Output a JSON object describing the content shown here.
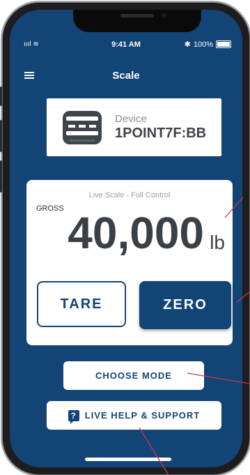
{
  "status_bar": {
    "time": "9:41 AM",
    "signal": "ıııl ≋",
    "bluetooth": "✱",
    "battery": "100%"
  },
  "header": {
    "menu_icon": "hamburger-menu-icon",
    "title": "Scale"
  },
  "device": {
    "icon": "scale-indicator-icon",
    "label": "Device",
    "name": "1POINT7F:BB"
  },
  "scale": {
    "mode_label": "Live Scale - Full Control",
    "gross_label": "GROSS",
    "weight": "40,000",
    "unit": "lb"
  },
  "buttons": {
    "tare": "TARE",
    "zero": "ZERO",
    "choose_mode": "CHOOSE MODE",
    "help": "LIVE HELP & SUPPORT",
    "help_icon_glyph": "?"
  },
  "colors": {
    "primary": "#134476",
    "card": "#ffffff",
    "text_dark": "#3b4046",
    "annotation": "#d0344a"
  }
}
